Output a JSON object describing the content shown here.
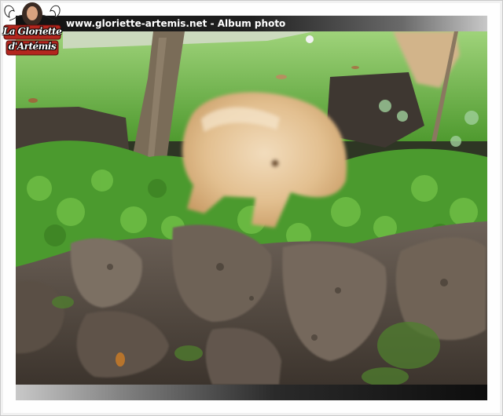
{
  "header": {
    "title": "www.gloriette-artemis.net - Album photo"
  },
  "logo": {
    "line1": "La Gloriette",
    "line2": "d'Artémis",
    "icon": "fairy-woman-emblem-icon"
  },
  "photo": {
    "subject": "photo-image"
  },
  "colors": {
    "header_dark": "#121212",
    "header_light": "#c8c8c8",
    "logo_red": "#b3261e",
    "frame_border": "#c9c9c9"
  }
}
